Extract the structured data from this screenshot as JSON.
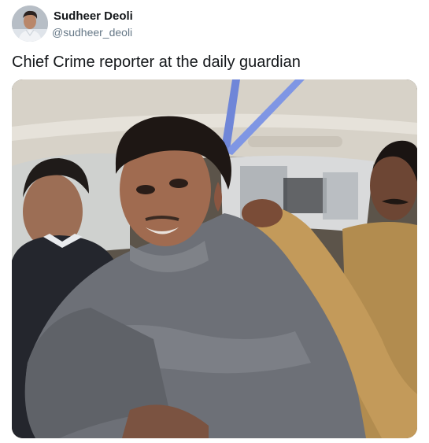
{
  "tweet": {
    "author": {
      "display_name": "Sudheer Deoli",
      "handle": "@sudheer_deoli",
      "avatar_icon": "user-avatar-photo"
    },
    "text": "Chief Crime reporter at the daily guardian",
    "media": {
      "kind": "photo",
      "icon": "photo-image"
    }
  },
  "colors": {
    "name_text": "#14171a",
    "handle_text": "#657786",
    "background": "#ffffff"
  }
}
